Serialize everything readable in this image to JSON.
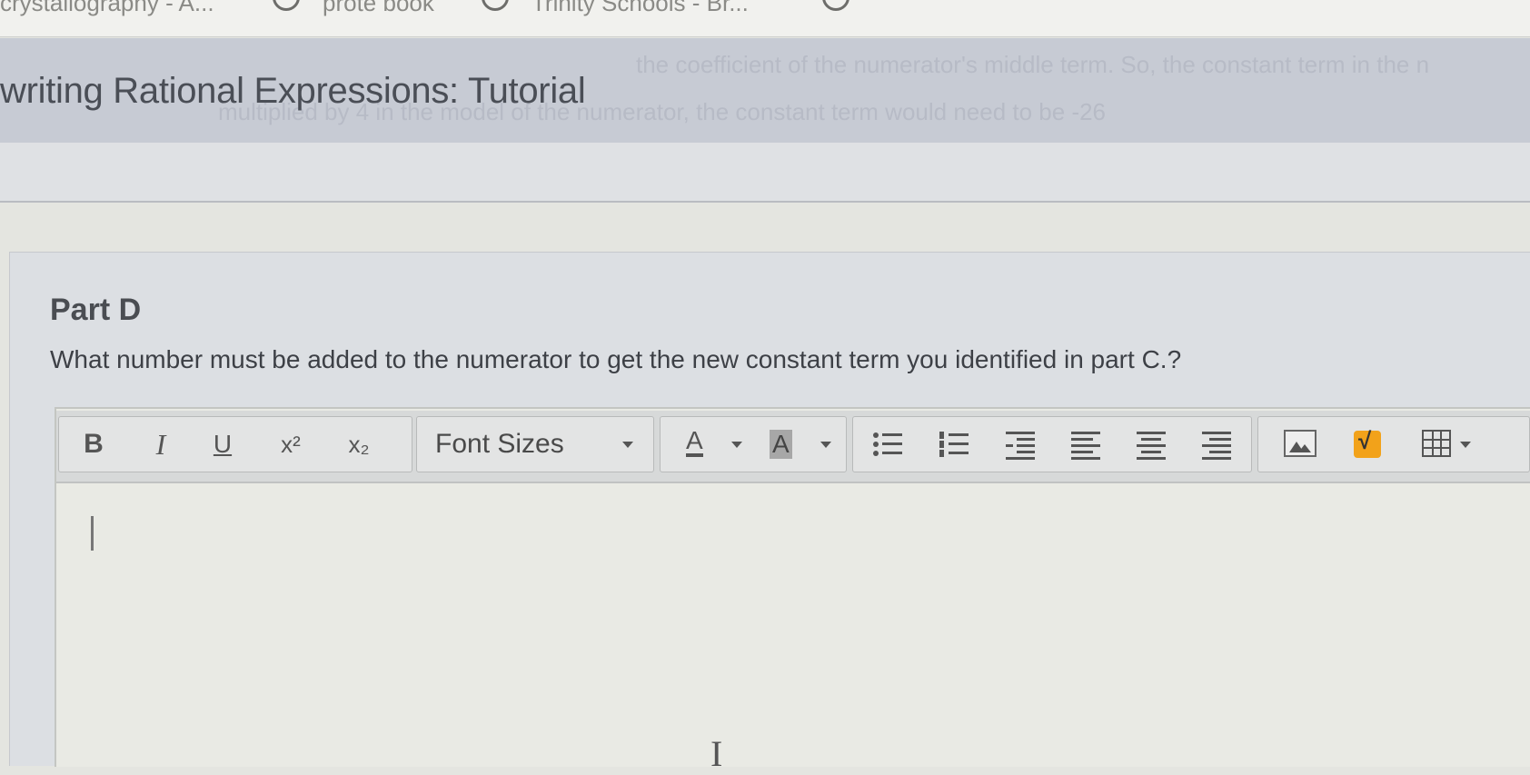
{
  "browser": {
    "bookmarks": [
      "crystallography - A...",
      "prote book",
      "Trinity Schools - Br..."
    ]
  },
  "header": {
    "title": "writing Rational Expressions: Tutorial",
    "faint_line_1": "the coefficient of the numerator's middle term. So, the constant term in the n",
    "faint_line_2": "multiplied by 4 in the model of the numerator, the constant term would need to be -26"
  },
  "part": {
    "title": "Part D",
    "question": "What number must be added to the numerator to get the new constant term you identified in part C.?"
  },
  "toolbar": {
    "bold": "B",
    "italic": "I",
    "underline": "U",
    "superscript": "x²",
    "subscript": "x₂",
    "font_sizes": "Font Sizes",
    "text_color": "A",
    "bg_color": "A"
  },
  "editor": {
    "content": ""
  },
  "colors": {
    "accent_math": "#f2a21a",
    "header_band": "#c7cbd4",
    "page_bg": "#e4e5e0"
  }
}
